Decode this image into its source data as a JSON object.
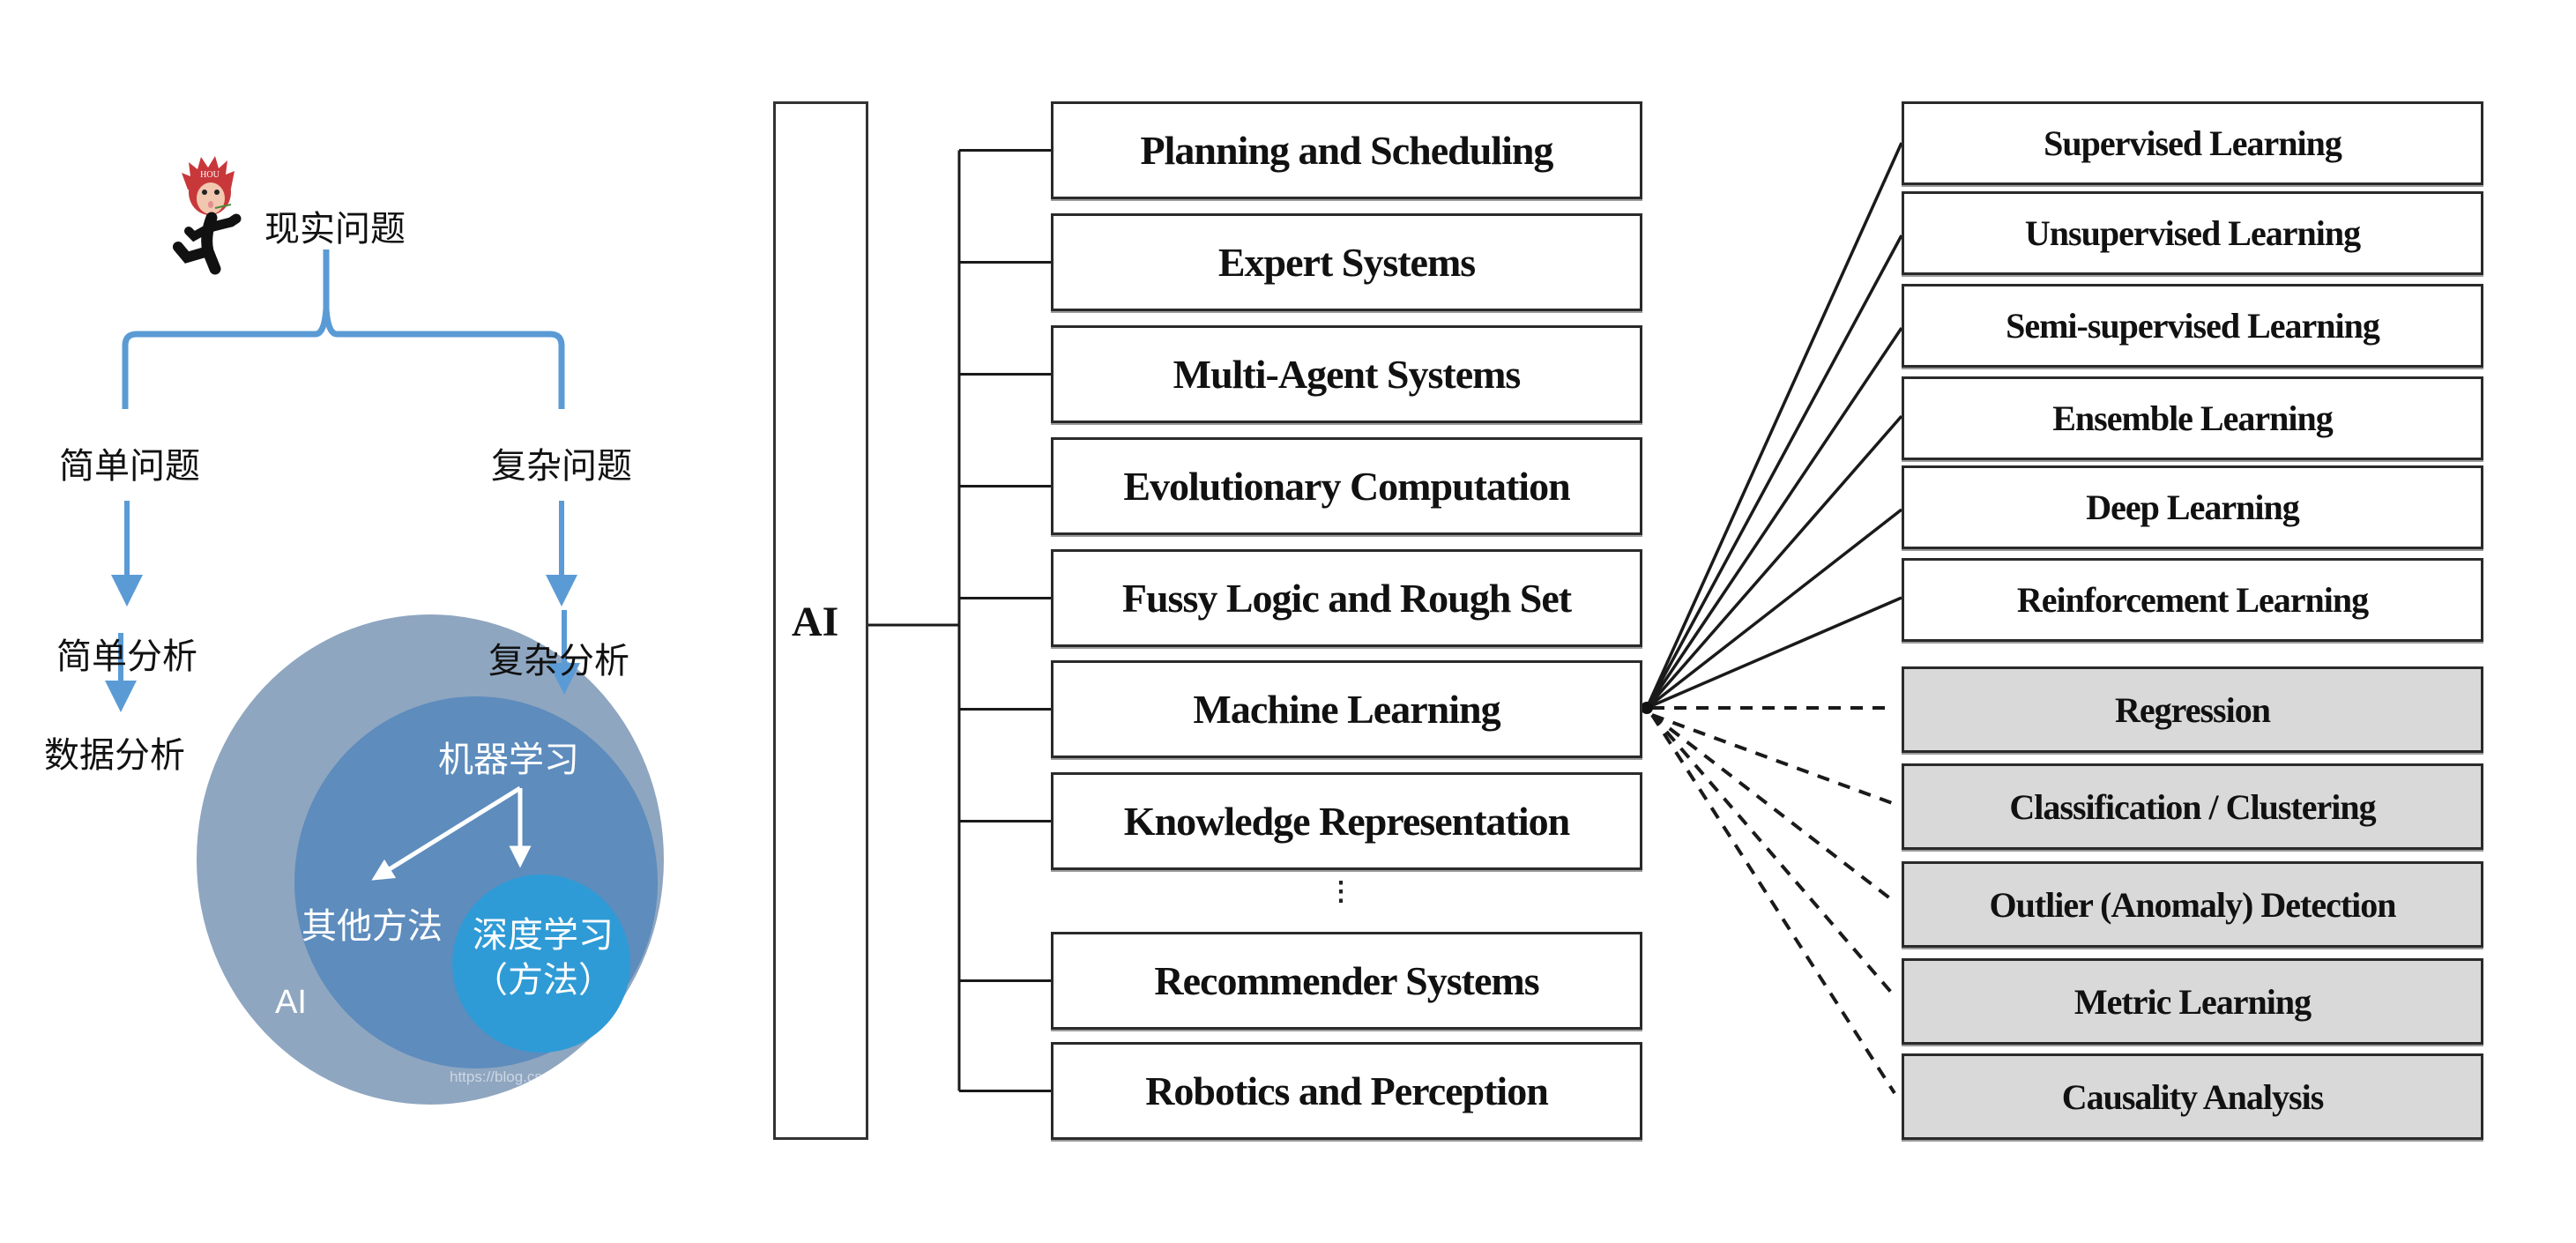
{
  "colors": {
    "arrow_blue": "#5b9bd5",
    "outer_circle": "#8fa6c0",
    "ml_circle": "#5d8cbd",
    "dl_circle": "#2f9bd6",
    "box_border": "#2a2a2a",
    "grey_fill": "#d9d9d9"
  },
  "left_panel": {
    "mascot": {
      "icon": "running-monkey-icon",
      "badge_text": "HOU"
    },
    "root": "现实问题",
    "branches": {
      "simple": {
        "problem": "简单问题",
        "analysis": "简单分析",
        "result": "数据分析"
      },
      "complex": {
        "problem": "复杂问题",
        "analysis": "复杂分析"
      }
    },
    "venn": {
      "outer_label": "AI",
      "middle_label": "机器学习",
      "other_label": "其他方法",
      "inner_label_line1": "深度学习",
      "inner_label_line2": "（方法）"
    },
    "watermark": "https://blog.csdn.net/u013250861"
  },
  "tree": {
    "root": "AI",
    "categories": [
      "Planning and Scheduling",
      "Expert Systems",
      "Multi-Agent Systems",
      "Evolutionary Computation",
      "Fussy Logic and Rough Set",
      "Machine Learning",
      "Knowledge Representation",
      "Recommender Systems",
      "Robotics and Perception"
    ],
    "ellipsis": "⋮",
    "ml_paradigms": [
      "Supervised Learning",
      "Unsupervised Learning",
      "Semi-supervised Learning",
      "Ensemble Learning",
      "Deep Learning",
      "Reinforcement Learning"
    ],
    "ml_tasks": [
      "Regression",
      "Classification / Clustering",
      "Outlier (Anomaly) Detection",
      "Metric Learning",
      "Causality Analysis"
    ]
  }
}
